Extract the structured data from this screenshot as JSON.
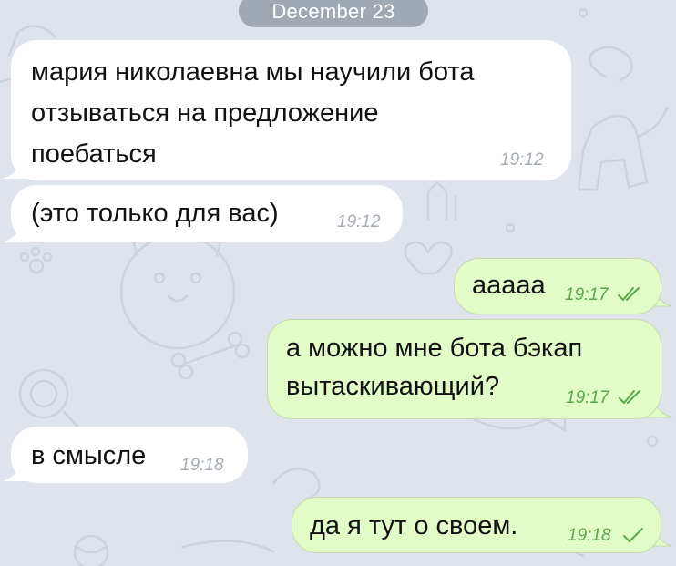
{
  "date_separator": "December 23",
  "colors": {
    "background": "#dfe4ec",
    "incoming_bubble": "#ffffff",
    "outgoing_bubble": "#e2fcc8",
    "outgoing_time": "#5ba74b",
    "incoming_time": "#a4abb4",
    "read_ticks": "#5ba74b"
  },
  "messages": [
    {
      "direction": "incoming",
      "lines": [
        "мария николаевна мы научили бота",
        "отзываться на предложение",
        "поебаться"
      ],
      "time": "19:12"
    },
    {
      "direction": "incoming",
      "lines": [
        "(это только для вас)"
      ],
      "time": "19:12"
    },
    {
      "direction": "outgoing",
      "lines": [
        "ааааа"
      ],
      "time": "19:17",
      "status": "read-double-check-icon"
    },
    {
      "direction": "outgoing",
      "lines": [
        "а можно мне бота бэкап",
        "вытаскивающий?"
      ],
      "time": "19:17",
      "status": "read-double-check-icon"
    },
    {
      "direction": "incoming",
      "lines": [
        "в смысле"
      ],
      "time": "19:18"
    },
    {
      "direction": "outgoing",
      "lines": [
        "да я тут о своем."
      ],
      "time": "19:18",
      "status": "sent-single-check-icon"
    }
  ]
}
